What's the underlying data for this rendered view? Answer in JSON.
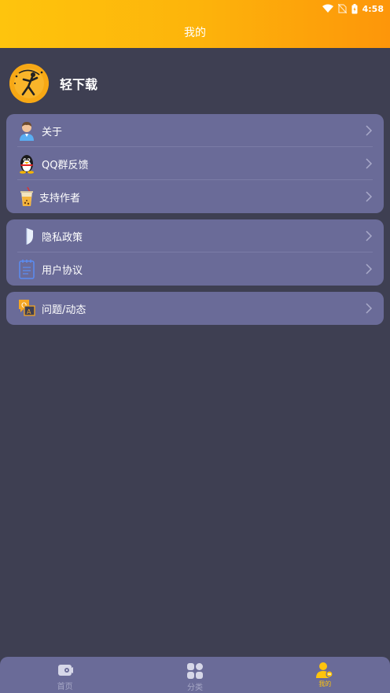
{
  "status": {
    "time": "4:58"
  },
  "header": {
    "title": "我的"
  },
  "profile": {
    "name": "轻下载"
  },
  "groups": [
    {
      "items": [
        {
          "label": "关于",
          "icon": "person-icon"
        },
        {
          "label": "QQ群反馈",
          "icon": "qq-penguin-icon"
        },
        {
          "label": "支持作者",
          "icon": "drink-cup-icon"
        }
      ]
    },
    {
      "items": [
        {
          "label": "隐私政策",
          "icon": "shield-icon"
        },
        {
          "label": "用户协议",
          "icon": "notepad-icon"
        }
      ]
    },
    {
      "items": [
        {
          "label": "问题/动态",
          "icon": "chat-question-icon"
        }
      ]
    }
  ],
  "tabbar": {
    "tabs": [
      {
        "label": "首页",
        "icon": "video-icon",
        "active": false
      },
      {
        "label": "分类",
        "icon": "grid-icon",
        "active": false
      },
      {
        "label": "我的",
        "icon": "user-icon",
        "active": true
      }
    ]
  },
  "colors": {
    "accent": "#fec40d",
    "background": "#3e3f52",
    "card": "#6a6b98"
  }
}
